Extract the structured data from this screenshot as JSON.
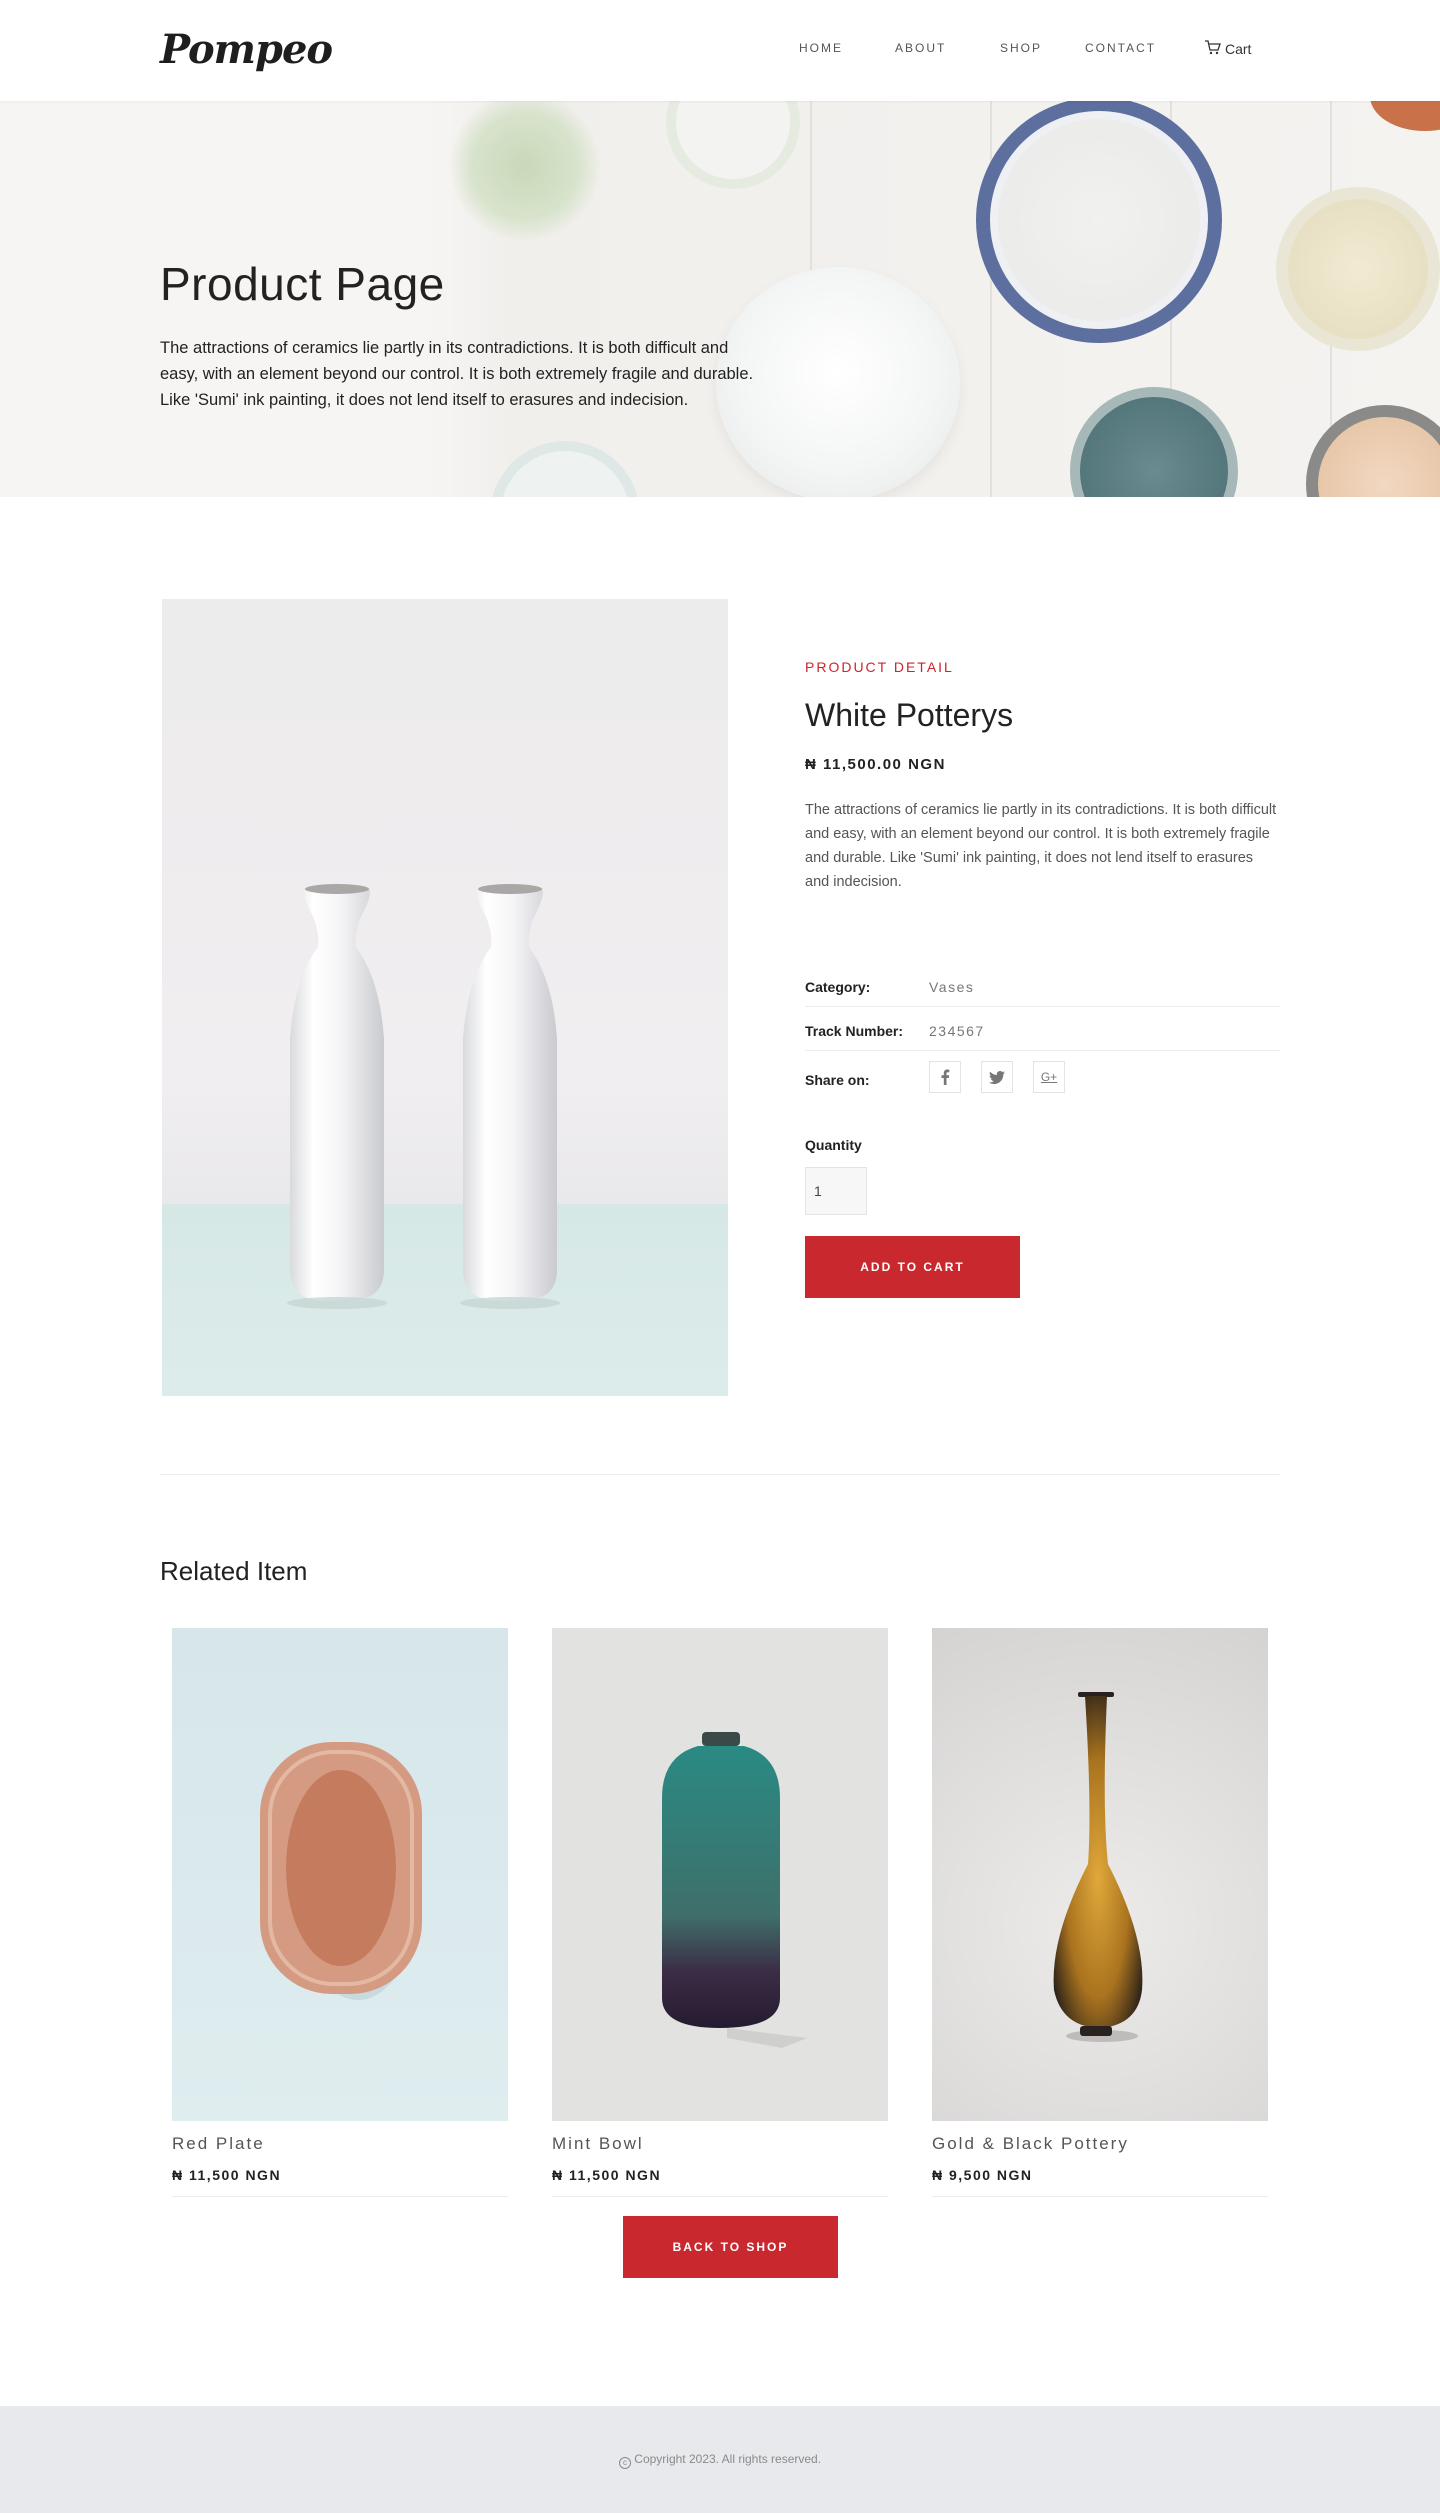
{
  "brand": {
    "logo": "Pompeo"
  },
  "nav": {
    "items": [
      {
        "label": "HOME"
      },
      {
        "label": "ABOUT"
      },
      {
        "label": "SHOP"
      },
      {
        "label": "CONTACT"
      }
    ],
    "cart_label": "Cart",
    "cart_icon": "cart-icon"
  },
  "hero": {
    "title": "Product Page",
    "text": "The attractions of ceramics lie partly in its contradictions. It is both difficult and easy, with an element beyond our control. It is both extremely fragile and durable. Like 'Sumi' ink painting, it does not lend itself to erasures and indecision."
  },
  "product": {
    "eyebrow": "PRODUCT DETAIL",
    "name": "White Potterys",
    "price": "₦ 11,500.00 NGN",
    "description": "The attractions of ceramics lie partly in its contradictions. It is both difficult and easy, with an element beyond our control. It is both extremely fragile and durable. Like 'Sumi' ink painting, it does not lend itself to erasures and indecision.",
    "meta": {
      "category_label": "Category:",
      "category_value": "Vases",
      "track_label": "Track Number:",
      "track_value": "234567",
      "share_label": "Share on:"
    },
    "share_icons": [
      "facebook-icon",
      "twitter-icon",
      "google-plus-icon"
    ],
    "quantity_label": "Quantity",
    "quantity_value": "1",
    "add_button": "ADD TO CART"
  },
  "related": {
    "title": "Related Item",
    "items": [
      {
        "name": "Red Plate",
        "price": "₦ 11,500 NGN"
      },
      {
        "name": "Mint Bowl",
        "price": "₦ 11,500 NGN"
      },
      {
        "name": "Gold & Black Pottery",
        "price": "₦ 9,500 NGN"
      }
    ],
    "back_button": "BACK TO SHOP"
  },
  "footer": {
    "copyright": "Copyright 2023. All rights reserved."
  },
  "colors": {
    "accent": "#c9282e",
    "footer_bg": "#e7e9ec"
  }
}
